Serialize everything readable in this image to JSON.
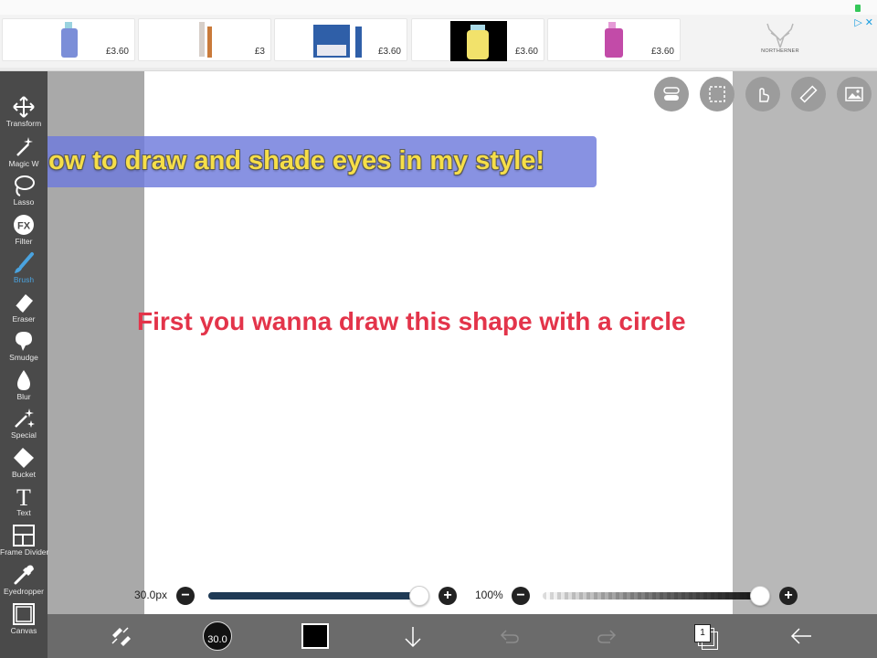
{
  "ad_banner": {
    "items": [
      {
        "price": "£3.60",
        "thumb_color": "#7b8ed8"
      },
      {
        "price": "£3",
        "thumb_color": "#c97a3a"
      },
      {
        "price": "£3.60",
        "thumb_color": "#2f5fa8"
      },
      {
        "price": "£3.60",
        "thumb_color": "#f2e26b"
      },
      {
        "price": "£3.60",
        "thumb_color": "#c24ba8"
      }
    ],
    "brand": "NORTHERNER"
  },
  "toolbar": {
    "items": [
      {
        "label": "Transform",
        "icon": "move-arrows-icon"
      },
      {
        "label": "Magic W",
        "icon": "magic-wand-icon"
      },
      {
        "label": "Lasso",
        "icon": "lasso-icon"
      },
      {
        "label": "Filter",
        "icon": "fx-icon"
      },
      {
        "label": "Brush",
        "icon": "brush-icon",
        "active": true
      },
      {
        "label": "Eraser",
        "icon": "eraser-icon"
      },
      {
        "label": "Smudge",
        "icon": "smudge-icon"
      },
      {
        "label": "Blur",
        "icon": "drop-icon"
      },
      {
        "label": "Special",
        "icon": "sparkle-icon"
      },
      {
        "label": "Bucket",
        "icon": "bucket-icon"
      },
      {
        "label": "Text",
        "icon": "text-icon"
      },
      {
        "label": "Frame Divider",
        "icon": "frame-divider-icon"
      },
      {
        "label": "Eyedropper",
        "icon": "eyedropper-icon"
      },
      {
        "label": "Canvas",
        "icon": "canvas-icon"
      }
    ],
    "fx_glyph": "FX",
    "text_glyph": "T"
  },
  "canvas": {
    "title": "How to draw and shade eyes in my style!",
    "caption": "First you wanna draw this shape with a circle"
  },
  "top_buttons": [
    "toggle-icon",
    "selection-icon",
    "hand-touch-icon",
    "ruler-icon",
    "image-icon"
  ],
  "sliders": {
    "size_label": "30.0px",
    "size_fraction": 0.98,
    "opacity_label": "100%",
    "opacity_fraction": 1.0,
    "minus": "−",
    "plus": "+"
  },
  "bottom_bar": {
    "brush_size": "30.0",
    "color": "#000000",
    "layer_count": "1"
  },
  "colors": {
    "title_text": "#f6de48",
    "caption_text": "#e3344a",
    "active_tool": "#4aa3df",
    "size_track": "#1f3a55"
  }
}
